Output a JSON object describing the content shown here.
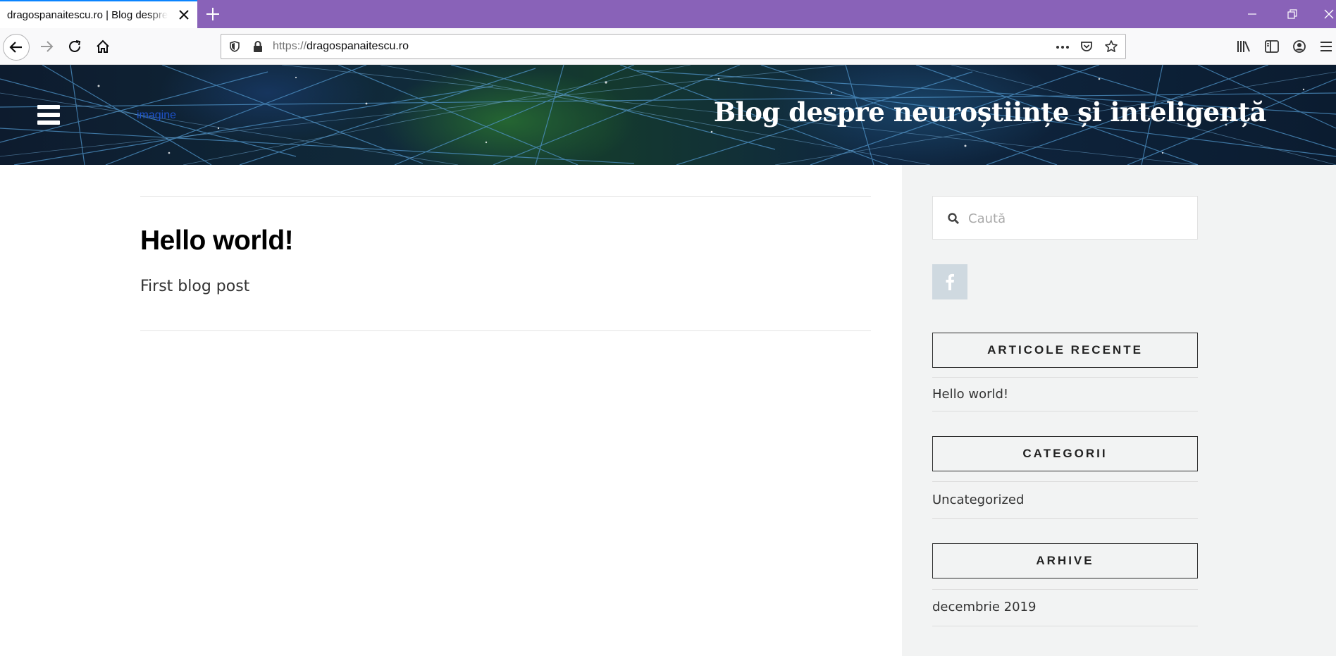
{
  "browser": {
    "tab_title": "dragospanaitescu.ro | Blog despre neuroștiințe și inteligență",
    "url_scheme": "https://",
    "url_host": "dragospanaitescu.ro",
    "accent_color": "#8962b8"
  },
  "header": {
    "logo_alt": "imagine",
    "site_title": "Blog despre neuroștiințe și inteligență"
  },
  "post": {
    "title": "Hello world!",
    "excerpt": "First blog post"
  },
  "sidebar": {
    "search_placeholder": "Caută",
    "social": [
      "facebook-icon"
    ],
    "widgets": [
      {
        "title": "ARTICOLE RECENTE",
        "items": [
          "Hello world!"
        ]
      },
      {
        "title": "CATEGORII",
        "items": [
          "Uncategorized"
        ]
      },
      {
        "title": "ARHIVE",
        "items": [
          "decembrie 2019"
        ]
      }
    ]
  }
}
